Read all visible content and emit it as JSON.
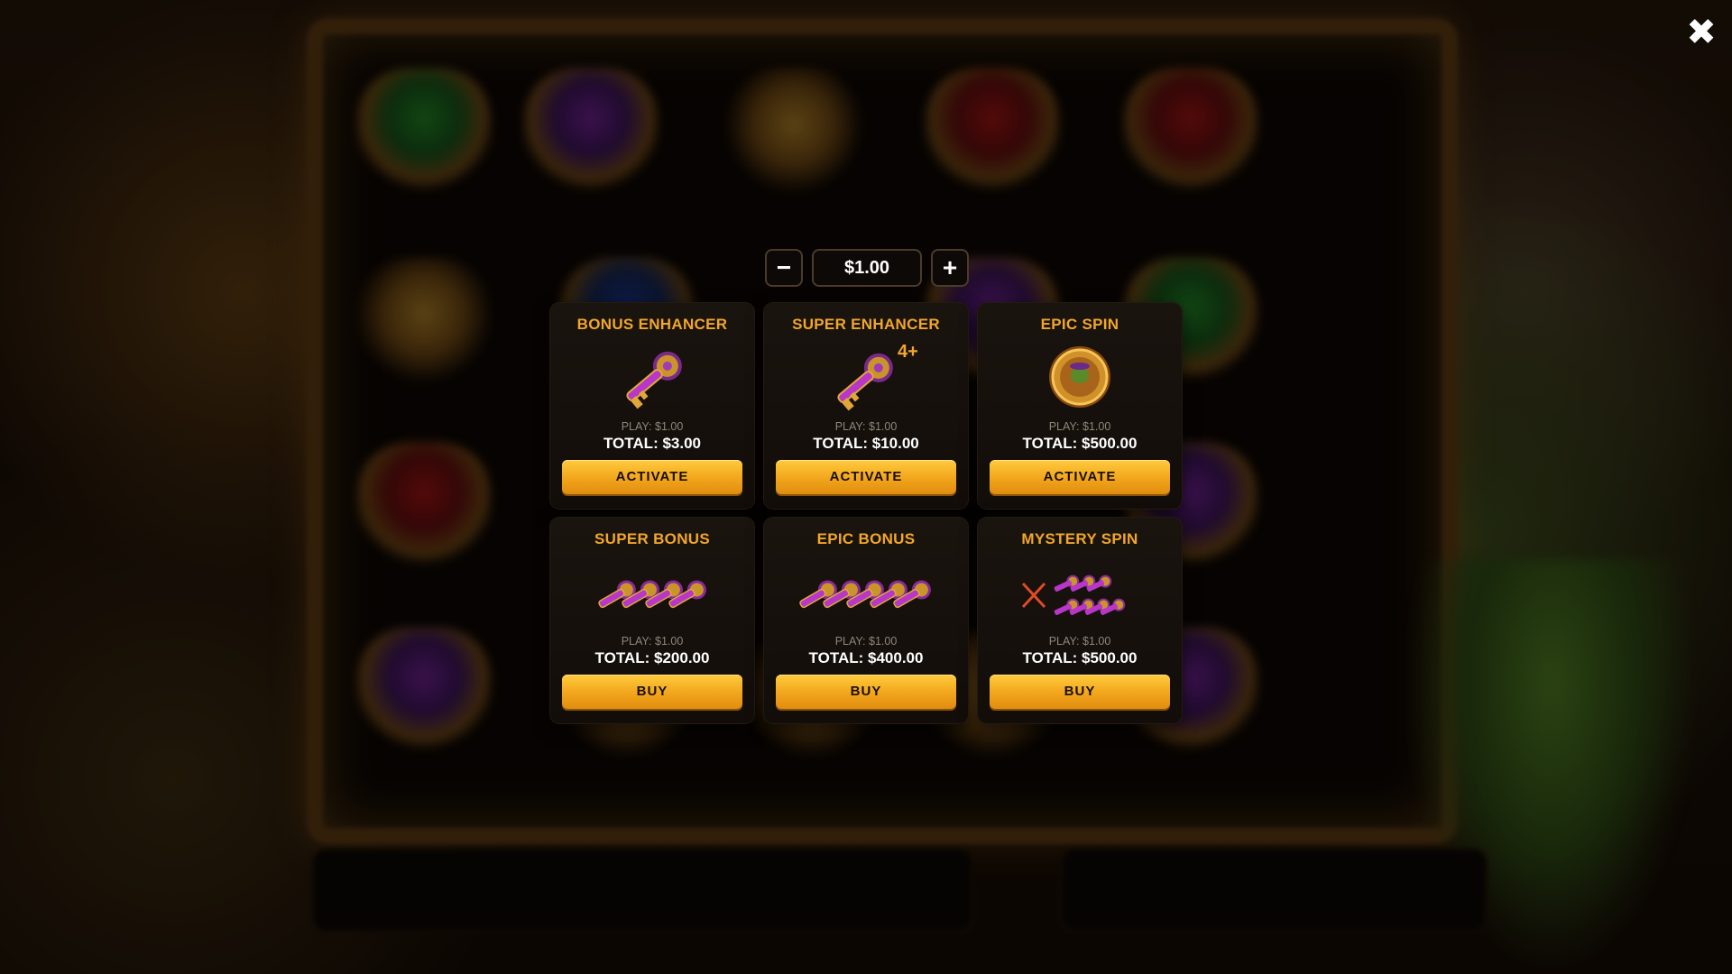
{
  "close": {
    "icon": "close-icon",
    "glyph": "✖"
  },
  "bet": {
    "value": "$1.00",
    "minus_glyph": "−",
    "plus_glyph": "+"
  },
  "colors": {
    "accent": "#f2a62a",
    "button": "#f8b52a",
    "card_bg": "#16100b"
  },
  "offers": [
    {
      "title": "BONUS ENHANCER",
      "play": "PLAY: $1.00",
      "total": "TOTAL: $3.00",
      "action": "ACTIVATE",
      "icon": "key-icon"
    },
    {
      "title": "SUPER ENHANCER",
      "play": "PLAY: $1.00",
      "total": "TOTAL: $10.00",
      "action": "ACTIVATE",
      "icon": "key-icon",
      "badge": "4+"
    },
    {
      "title": "EPIC SPIN",
      "play": "PLAY: $1.00",
      "total": "TOTAL: $500.00",
      "action": "ACTIVATE",
      "icon": "coin-icon"
    },
    {
      "title": "SUPER BONUS",
      "play": "PLAY: $1.00",
      "total": "TOTAL: $200.00",
      "action": "BUY",
      "icon": "keys-icon",
      "key_count": 4
    },
    {
      "title": "EPIC BONUS",
      "play": "PLAY: $1.00",
      "total": "TOTAL: $400.00",
      "action": "BUY",
      "icon": "keys-icon",
      "key_count": 5
    },
    {
      "title": "MYSTERY SPIN",
      "play": "PLAY: $1.00",
      "total": "TOTAL: $500.00",
      "action": "BUY",
      "icon": "mystery-keys-icon"
    }
  ]
}
